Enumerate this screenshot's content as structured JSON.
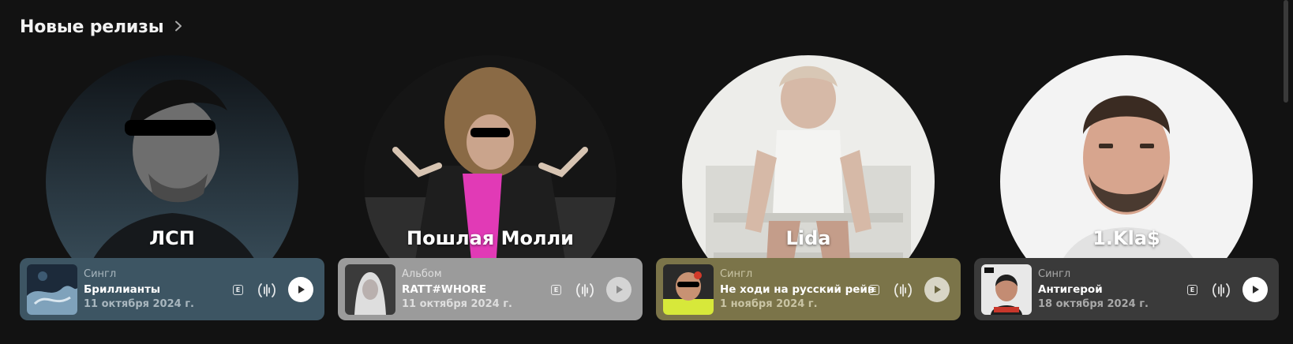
{
  "section": {
    "title": "Новые релизы",
    "chevron_icon": "chevron-right-icon"
  },
  "theme": {
    "background": "#121212",
    "text": "#ffffff"
  },
  "cards": [
    {
      "artist": "ЛСП",
      "release_type": "Сингл",
      "release_title": "Бриллианты",
      "release_date": "11 октября 2024 г.",
      "explicit_label": "E",
      "bar_color": "#3d5563",
      "meta_color": "#a8b6be",
      "play_color": "#ffffff"
    },
    {
      "artist": "Пошлая Молли",
      "release_type": "Альбом",
      "release_title": "RATT#WHORE",
      "release_date": "11 октября 2024 г.",
      "explicit_label": "E",
      "bar_color": "#9b9b9b",
      "meta_color": "#dedede",
      "play_color": "#d4d4d4"
    },
    {
      "artist": "Lida",
      "release_type": "Сингл",
      "release_title": "Не ходи на русский рейв",
      "release_date": "1 ноября 2024 г.",
      "explicit_label": "E",
      "bar_color": "#7b7449",
      "meta_color": "#c9c4a4",
      "play_color": "#d8d5c6"
    },
    {
      "artist": "1.Kla$",
      "release_type": "Сингл",
      "release_title": "Антигерой",
      "release_date": "18 октября 2024 г.",
      "explicit_label": "E",
      "bar_color": "#3a3a3a",
      "meta_color": "#a9a9a9",
      "play_color": "#ffffff"
    }
  ]
}
